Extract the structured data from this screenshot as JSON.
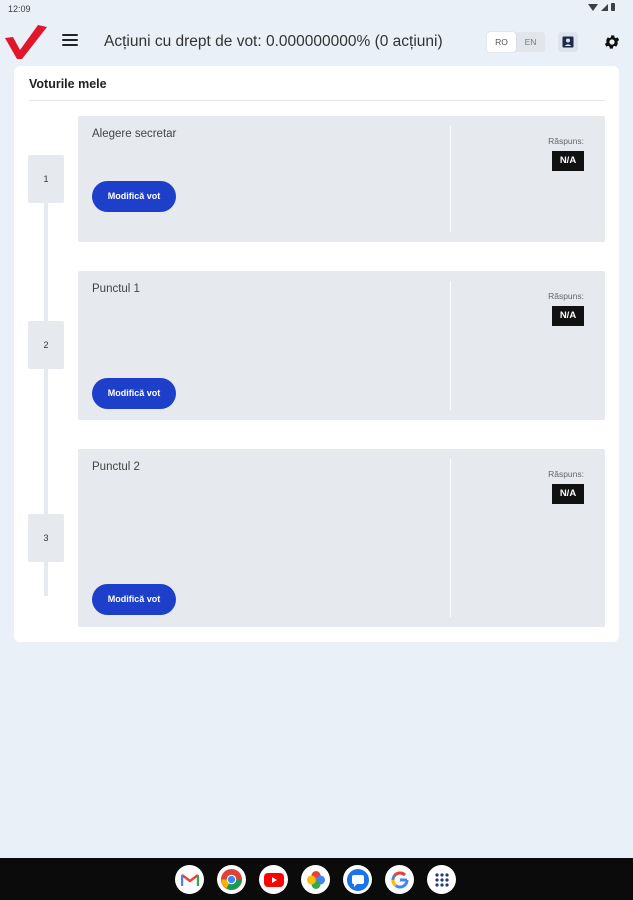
{
  "status_bar": {
    "time": "12:09"
  },
  "header": {
    "title": "Acțiuni cu drept de vot: 0.000000000% (0 acțiuni)",
    "lang_options": [
      "RO",
      "EN"
    ],
    "lang_selected": "RO"
  },
  "card": {
    "title": "Voturile mele",
    "items": [
      {
        "step": "1",
        "title": "Alegere secretar",
        "response_label": "Răspuns:",
        "response_value": "N/A",
        "button": "Modifică vot"
      },
      {
        "step": "2",
        "title": "Punctul 1",
        "response_label": "Răspuns:",
        "response_value": "N/A",
        "button": "Modifică vot"
      },
      {
        "step": "3",
        "title": "Punctul 2",
        "response_label": "Răspuns:",
        "response_value": "N/A",
        "button": "Modifică vot"
      }
    ]
  },
  "colors": {
    "brand_red": "#e1162b",
    "button_blue": "#1e3fc9",
    "background": "#eaf0f8"
  },
  "dock_icons": [
    "gmail-icon",
    "chrome-icon",
    "youtube-icon",
    "photos-icon",
    "messages-icon",
    "google-app-icon",
    "app-drawer-icon"
  ]
}
